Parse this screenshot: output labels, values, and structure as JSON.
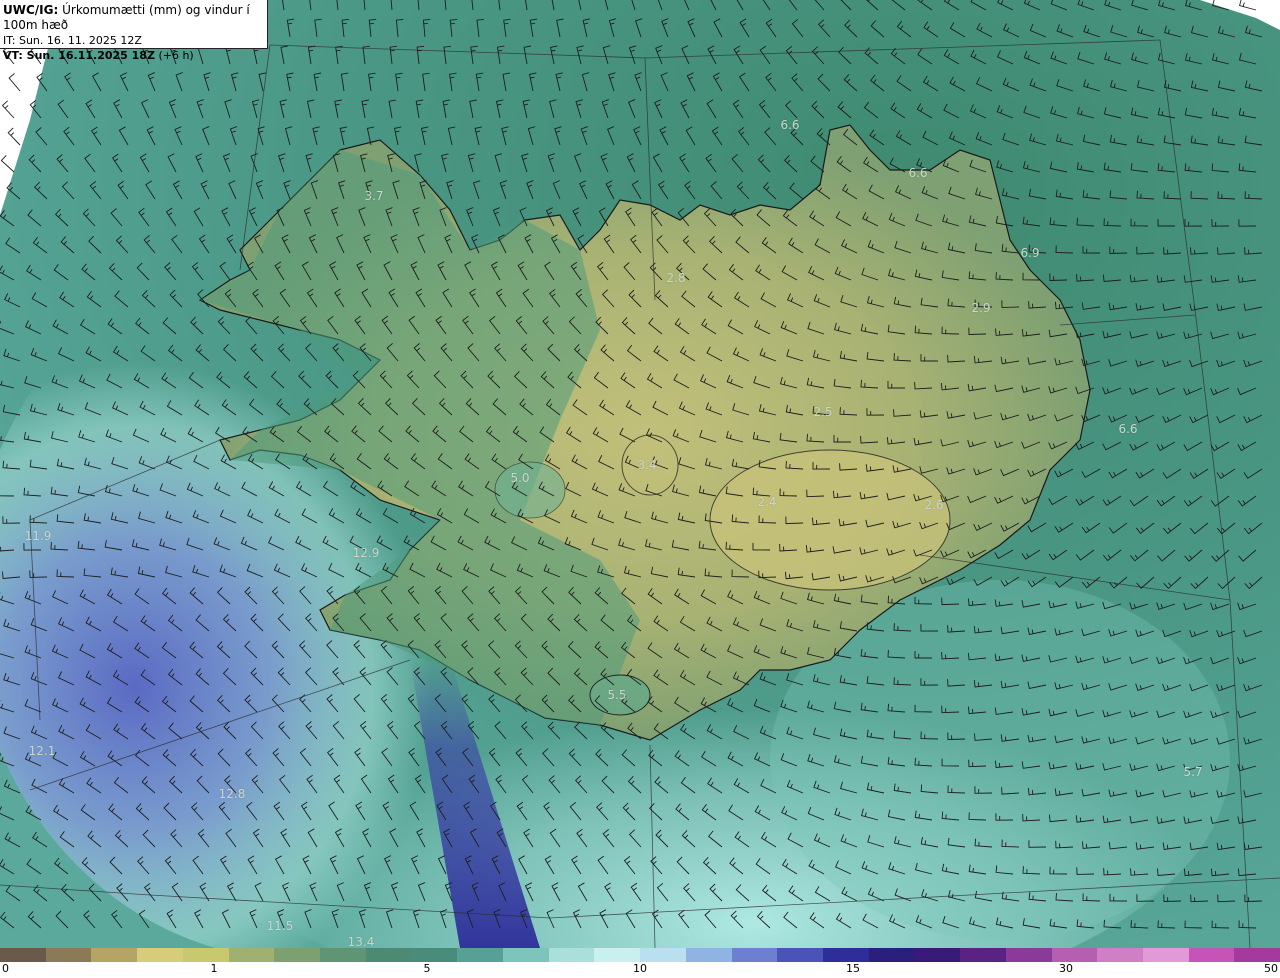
{
  "header": {
    "model": "UWC/IG:",
    "description": "Úrkomumætti (mm) og vindur í 100m hæð",
    "init_time": "IT: Sun. 16. 11. 2025 12Z",
    "valid_label": "VT: Sun. 16.11.2025 18Z",
    "valid_suffix": "(+6 h)"
  },
  "map_values": [
    {
      "text": "6.6"
    },
    {
      "text": "6.6"
    },
    {
      "text": "3.7"
    },
    {
      "text": "6.9"
    },
    {
      "text": "2.8"
    },
    {
      "text": "2.9"
    },
    {
      "text": "2.5"
    },
    {
      "text": "6.6"
    },
    {
      "text": "3.4"
    },
    {
      "text": "5.0"
    },
    {
      "text": "2.4"
    },
    {
      "text": "2.6"
    },
    {
      "text": "12.9"
    },
    {
      "text": "11.9"
    },
    {
      "text": "5.5"
    },
    {
      "text": "12.1"
    },
    {
      "text": "12.8"
    },
    {
      "text": "5.7"
    },
    {
      "text": "11.5"
    },
    {
      "text": "13.4"
    }
  ],
  "colorbar": {
    "ticks": [
      "0",
      "1",
      "5",
      "10",
      "15",
      "30",
      "50"
    ],
    "colors": [
      "#6b5a4a",
      "#8a7a56",
      "#b5a565",
      "#d6cc7a",
      "#c8c870",
      "#9fb070",
      "#7e9f70",
      "#5f9474",
      "#4d8a72",
      "#4a8c7c",
      "#57a096",
      "#7cc4bc",
      "#a9e0dc",
      "#c8f0ef",
      "#b9dff0",
      "#8fb3e3",
      "#6c7fd0",
      "#4a53b8",
      "#2d2e9a",
      "#2a1f7d",
      "#3a1a78",
      "#5a2383",
      "#8a3a98",
      "#b55fb0",
      "#cf7fc6",
      "#e19ad7",
      "#c653b7",
      "#a43a9e"
    ]
  },
  "colors": {
    "sea_base": "#4a9785",
    "land_low": "#5f9474",
    "land_high": "#b9ba74",
    "wet": "#a9e0dc",
    "very_wet": "#5563c2",
    "wedge": "#e8ece8"
  }
}
